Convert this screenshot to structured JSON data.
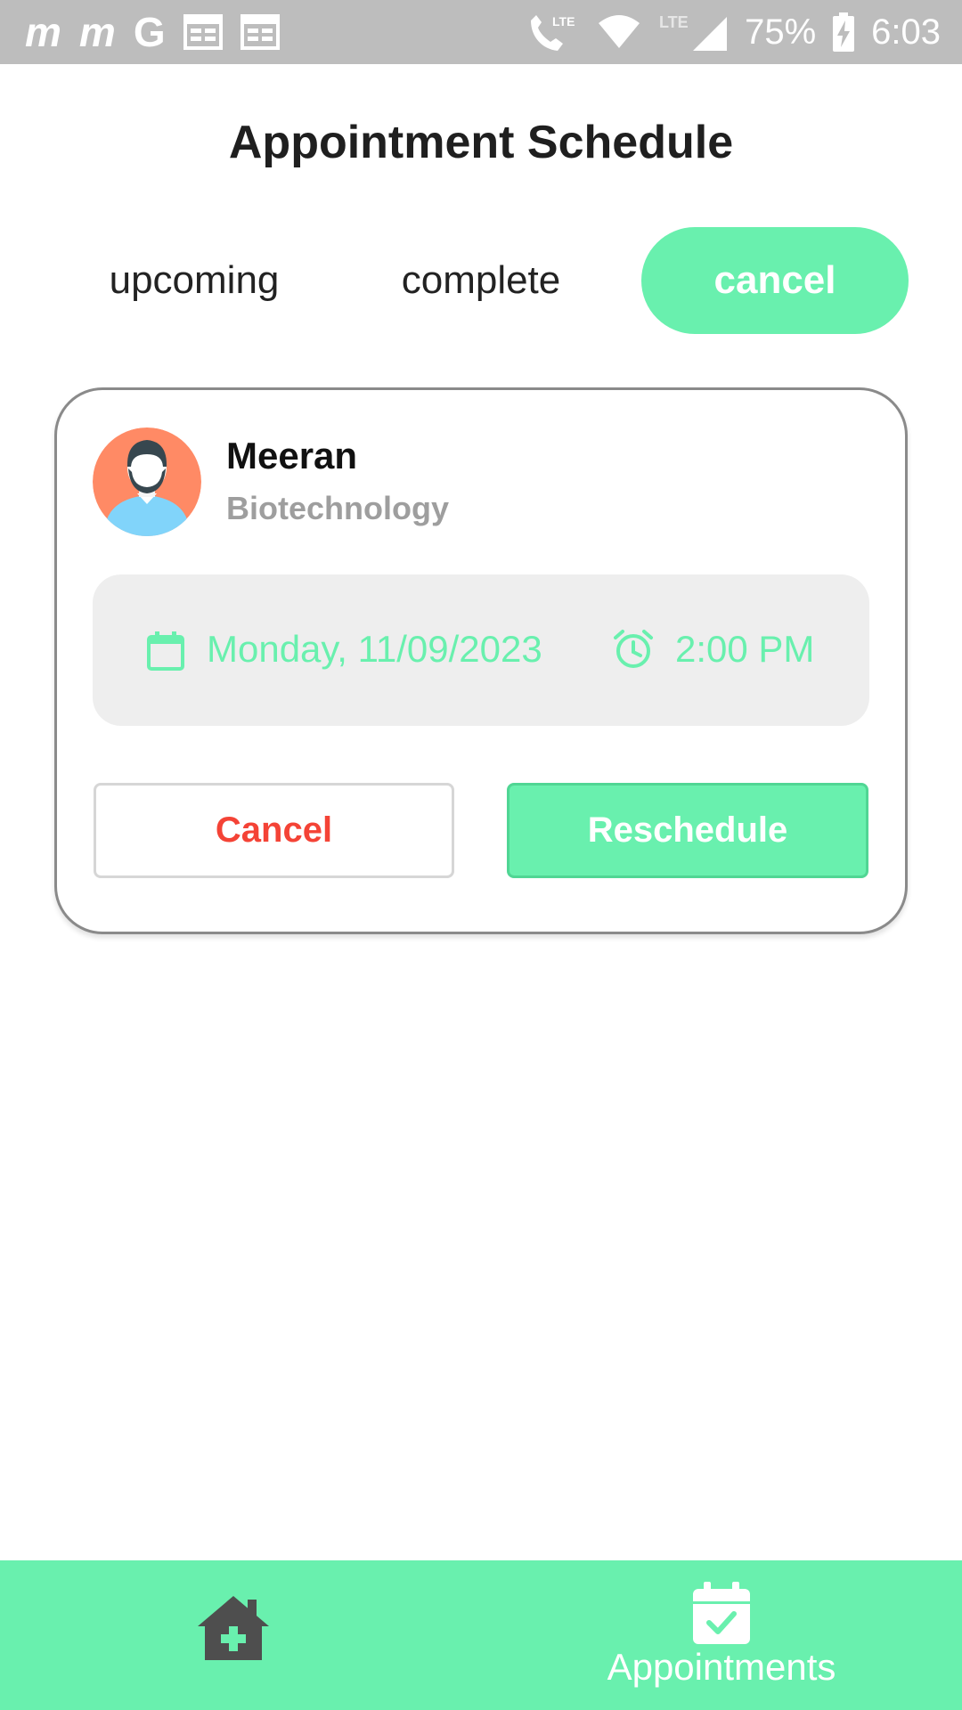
{
  "status_bar": {
    "left_glyphs": [
      "m",
      "m",
      "G"
    ],
    "battery": "75%",
    "time": "6:03",
    "icons": [
      "messaging-icon",
      "messaging-icon",
      "google-icon",
      "calendar-notification-icon",
      "calendar-notification-icon",
      "lte-call-icon",
      "wifi-icon",
      "lte-signal-icon",
      "battery-charging-icon"
    ],
    "lte_label": "LTE"
  },
  "header": {
    "title": "Appointment Schedule"
  },
  "tabs": [
    {
      "label": "upcoming",
      "active": false
    },
    {
      "label": "complete",
      "active": false
    },
    {
      "label": "cancel",
      "active": true
    }
  ],
  "appointment": {
    "doctor_name": "Meeran",
    "department": "Biotechnology",
    "date": "Monday, 11/09/2023",
    "time": "2:00 PM",
    "cancel_label": "Cancel",
    "reschedule_label": "Reschedule"
  },
  "bottom_nav": {
    "home_icon": "home-medical-icon",
    "appointments_label": "Appointments",
    "appointments_icon": "calendar-check-icon"
  },
  "colors": {
    "accent": "#69f0ae",
    "danger": "#f44336",
    "status_bar": "#bdbdbd",
    "muted": "#9e9e9e"
  }
}
